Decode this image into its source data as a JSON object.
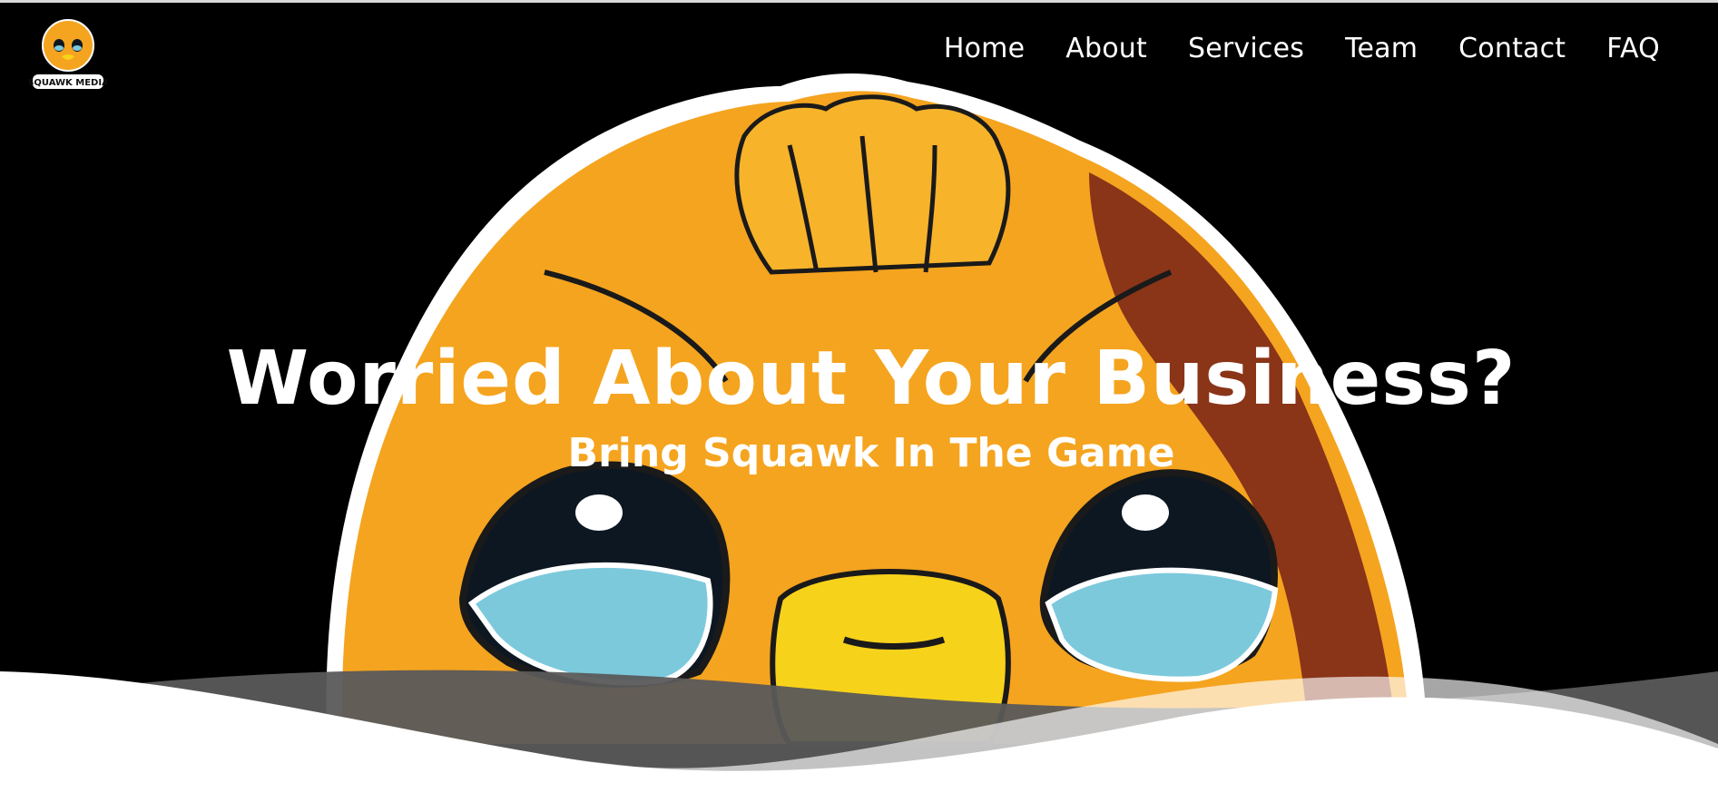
{
  "brand": {
    "logo_text": "SQUAWK MEDIA",
    "logo_icon": "duck-mascot-icon"
  },
  "nav": {
    "items": [
      {
        "label": "Home"
      },
      {
        "label": "About"
      },
      {
        "label": "Services"
      },
      {
        "label": "Team"
      },
      {
        "label": "Contact"
      },
      {
        "label": "FAQ"
      }
    ]
  },
  "hero": {
    "headline": "Worried About Your Business?",
    "subheadline": "Bring Squawk In The Game",
    "background_image": "worried-duck-mascot-illustration"
  },
  "colors": {
    "background": "#000000",
    "text": "#ffffff",
    "duck_orange": "#f5a41f",
    "duck_yellow": "#f7d21a",
    "duck_brown": "#8a3418",
    "tear_blue": "#7cc9dc",
    "wave_white": "#ffffff",
    "wave_gray": "#5a5a5a"
  }
}
